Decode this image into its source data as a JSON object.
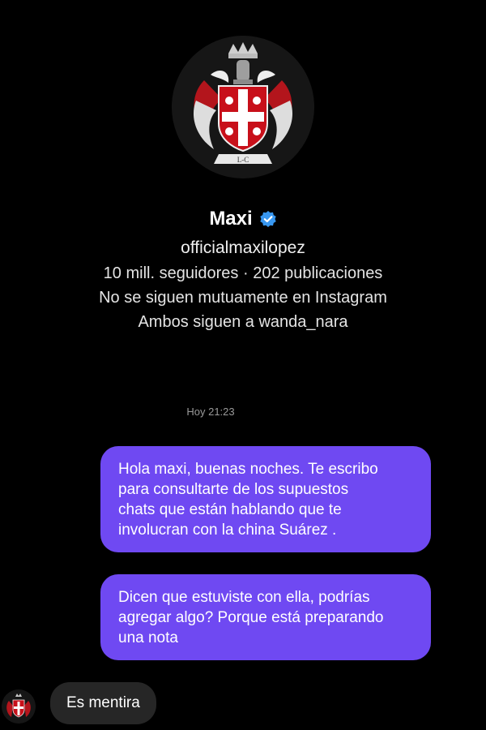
{
  "profile": {
    "crest_text": "L-C",
    "name": "Maxi",
    "handle": "officialmaxilopez",
    "stats": "10 mill. seguidores · 202 publicaciones",
    "mutual_status": "No se siguen mutuamente en Instagram",
    "common_follow": "Ambos siguen a wanda_nara",
    "verified_icon": "verified-badge-icon",
    "verified_color": "#3897f0"
  },
  "chat": {
    "timestamp": "Hoy 21:23",
    "messages": [
      {
        "from": "me",
        "text": "Hola maxi, buenas noches. Te escribo\npara consultarte de los supuestos\nchats que están hablando que te\ninvolucran con la china Suárez ."
      },
      {
        "from": "me",
        "text": "Dicen que estuviste con ella, podrías\nagregar algo? Porque está preparando\nuna nota"
      },
      {
        "from": "them",
        "text": "Es mentira"
      }
    ],
    "bubble_color": "#6f49f2",
    "reply_color": "#262626"
  }
}
